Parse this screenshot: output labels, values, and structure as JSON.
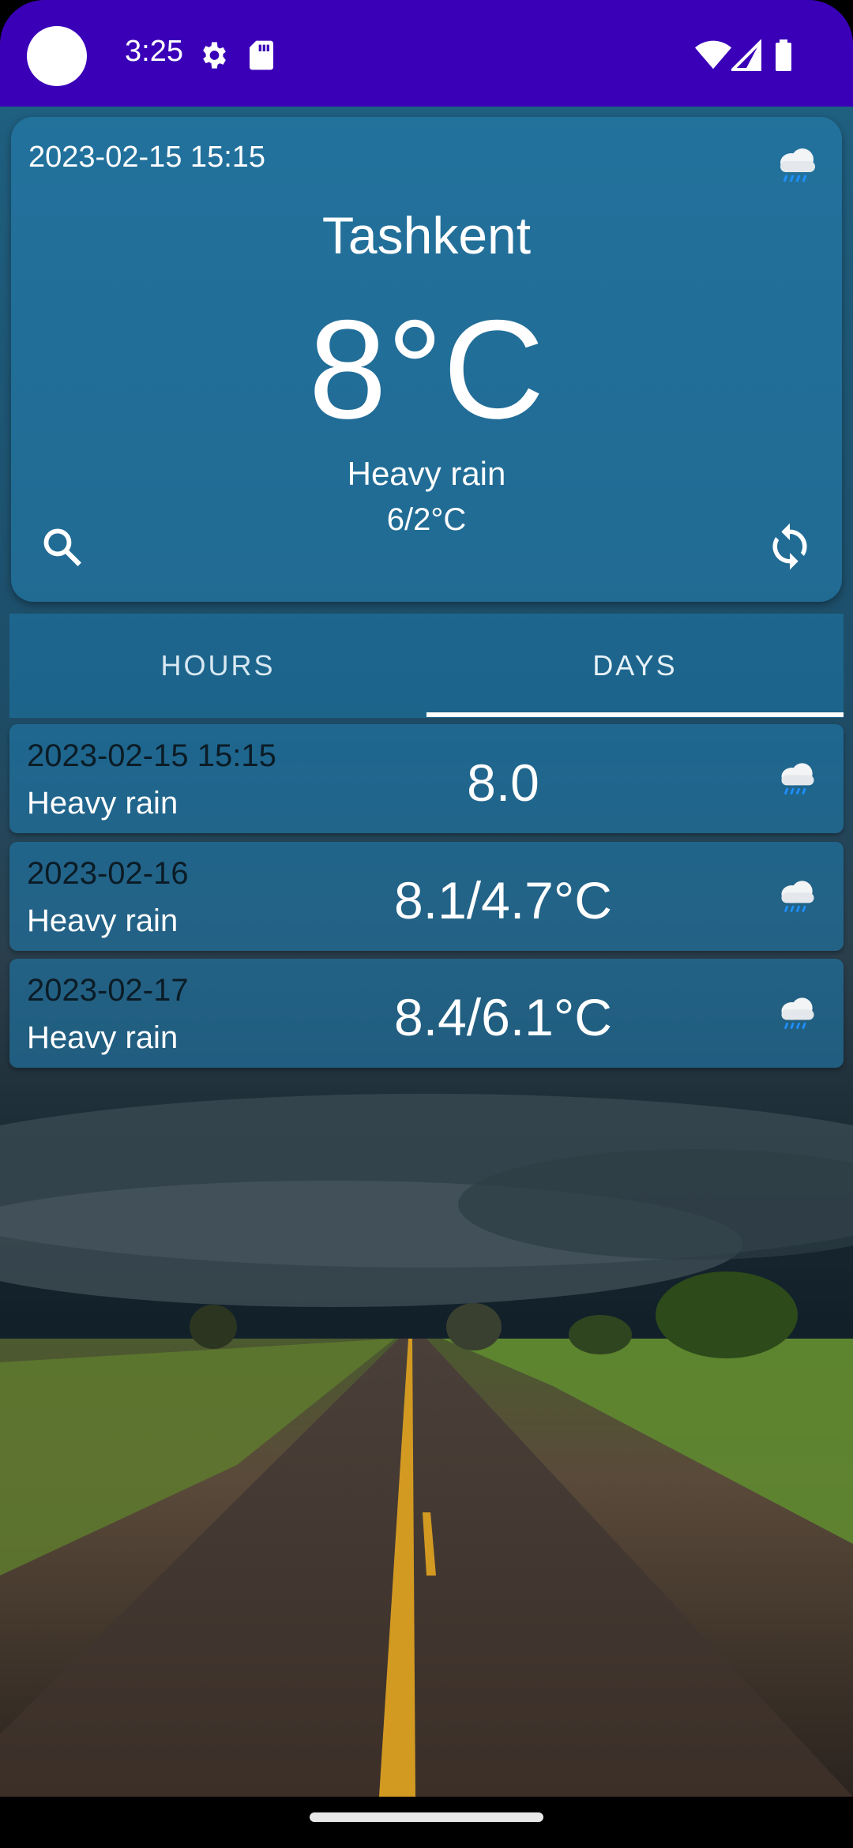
{
  "status_bar": {
    "time": "3:25"
  },
  "current": {
    "timestamp": "2023-02-15 15:15",
    "city": "Tashkent",
    "temperature": "8°C",
    "condition": "Heavy rain",
    "range": "6/2°C",
    "icon": "rain-cloud-icon"
  },
  "tabs": [
    {
      "label": "HOURS",
      "selected": false
    },
    {
      "label": "DAYS",
      "selected": true
    }
  ],
  "forecast": [
    {
      "date": "2023-02-15 15:15",
      "condition": "Heavy rain",
      "value": "8.0",
      "icon": "rain-cloud-icon"
    },
    {
      "date": "2023-02-16",
      "condition": "Heavy rain",
      "value": "8.1/4.7°C",
      "icon": "rain-cloud-icon"
    },
    {
      "date": "2023-02-17",
      "condition": "Heavy rain",
      "value": "8.4/6.1°C",
      "icon": "rain-cloud-icon"
    }
  ],
  "colors": {
    "status_bar": "#3a00b8",
    "card": "#2482b4",
    "accent_blue": "#1e90ff"
  }
}
